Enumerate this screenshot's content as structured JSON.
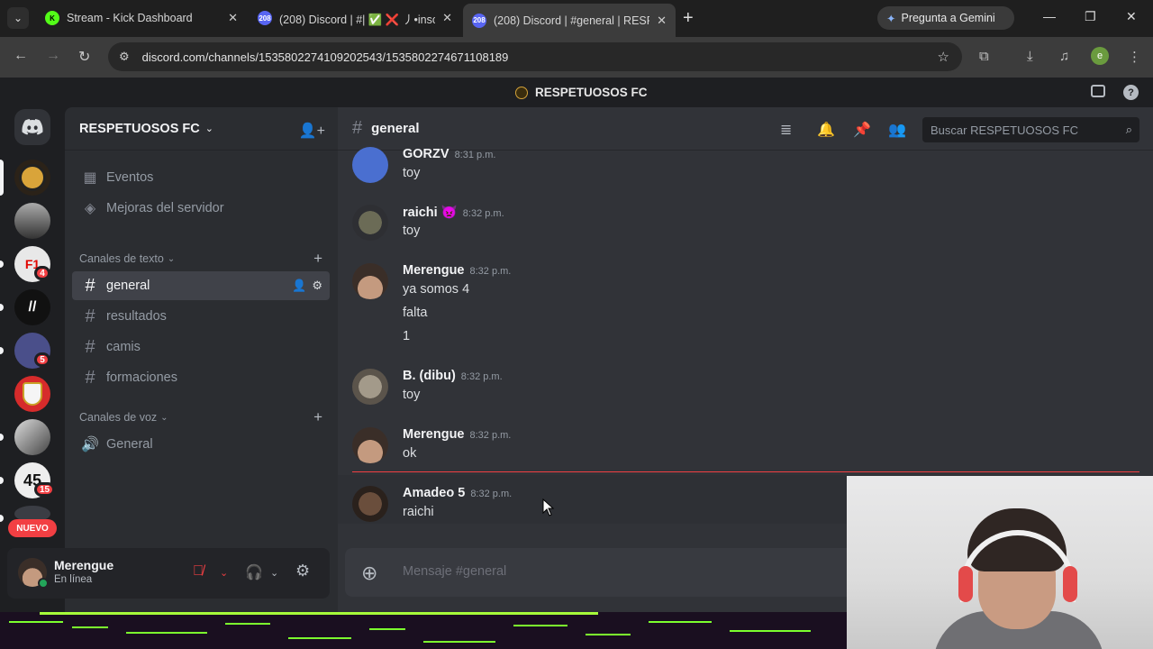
{
  "browser": {
    "tabs": [
      {
        "title": "Stream - Kick Dashboard",
        "favicon": "kick-logo-icon",
        "color": "#53fc18"
      },
      {
        "title": "(208) Discord | #| ✅ ❌ 丿•inscr",
        "favicon": "discord-favicon-icon",
        "color": "#5865f2",
        "badge": "208"
      },
      {
        "title": "(208) Discord | #general | RESPE",
        "favicon": "discord-favicon-icon",
        "color": "#5865f2",
        "badge": "208"
      }
    ],
    "gemini_label": "Pregunta a Gemini",
    "url": "discord.com/channels/1535802274109202543/1535802274671108189",
    "profile_initial": "e"
  },
  "discord": {
    "top_title": "RESPETUOSOS FC",
    "server": {
      "name": "RESPETUOSOS FC",
      "menu_items": [
        {
          "label": "Eventos",
          "icon": "calendar-icon"
        },
        {
          "label": "Mejoras del servidor",
          "icon": "boost-icon"
        }
      ],
      "text_category": "Canales de texto",
      "text_channels": [
        {
          "name": "general",
          "active": true
        },
        {
          "name": "resultados"
        },
        {
          "name": "camis"
        },
        {
          "name": "formaciones"
        }
      ],
      "voice_category": "Canales de voz",
      "voice_channels": [
        {
          "name": "General"
        }
      ]
    },
    "rail": {
      "badges": [
        "4",
        "5",
        "15"
      ],
      "new_label": "NUEVO"
    },
    "user": {
      "name": "Merengue",
      "status": "En línea"
    },
    "channel": {
      "name": "general",
      "search_placeholder": "Buscar RESPETUOSOS FC",
      "composer_placeholder": "Mensaje #general"
    },
    "messages": [
      {
        "author": "GORZV",
        "time": "8:31 p.m.",
        "lines": [
          "toy"
        ]
      },
      {
        "author": "raichi 👿",
        "time": "8:32 p.m.",
        "lines": [
          "toy"
        ]
      },
      {
        "author": "Merengue",
        "time": "8:32 p.m.",
        "lines": [
          "ya somos 4",
          "falta",
          "1"
        ]
      },
      {
        "author": "B. (dibu)",
        "time": "8:32 p.m.",
        "lines": [
          "toy"
        ]
      },
      {
        "author": "Merengue",
        "time": "8:32 p.m.",
        "lines": [
          "ok"
        ]
      },
      {
        "author": "Amadeo 5",
        "time": "8:32 p.m.",
        "lines": [
          "raichi"
        ]
      }
    ]
  },
  "colors": {
    "accent": "#5865f2",
    "online": "#23a55a",
    "mention_red": "#f23f43"
  }
}
